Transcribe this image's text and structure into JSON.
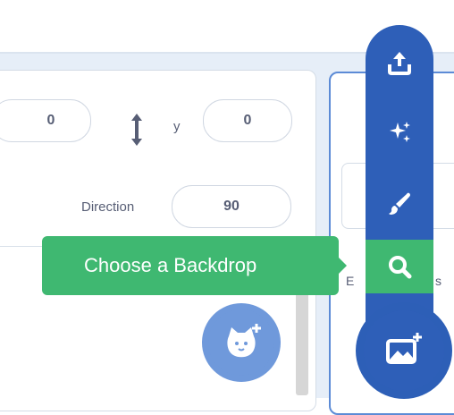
{
  "sprite_info": {
    "x_value": "0",
    "y_label": "y",
    "y_value": "0",
    "direction_label": "Direction",
    "direction_value": "90"
  },
  "tooltip": {
    "text": "Choose a Backdrop"
  },
  "backdrop_panel": {
    "label_start": "E",
    "label_end": "s"
  },
  "menu": {
    "items": [
      {
        "icon": "upload-icon"
      },
      {
        "icon": "surprise-icon"
      },
      {
        "icon": "paint-icon"
      },
      {
        "icon": "search-icon"
      }
    ]
  },
  "buttons": {
    "choose_sprite_icon": "cat-add-icon",
    "choose_backdrop_icon": "image-add-icon"
  },
  "colors": {
    "accent": "#2e5fb8",
    "tooltip_green": "#3fb871",
    "fab_light": "#6f99db"
  }
}
